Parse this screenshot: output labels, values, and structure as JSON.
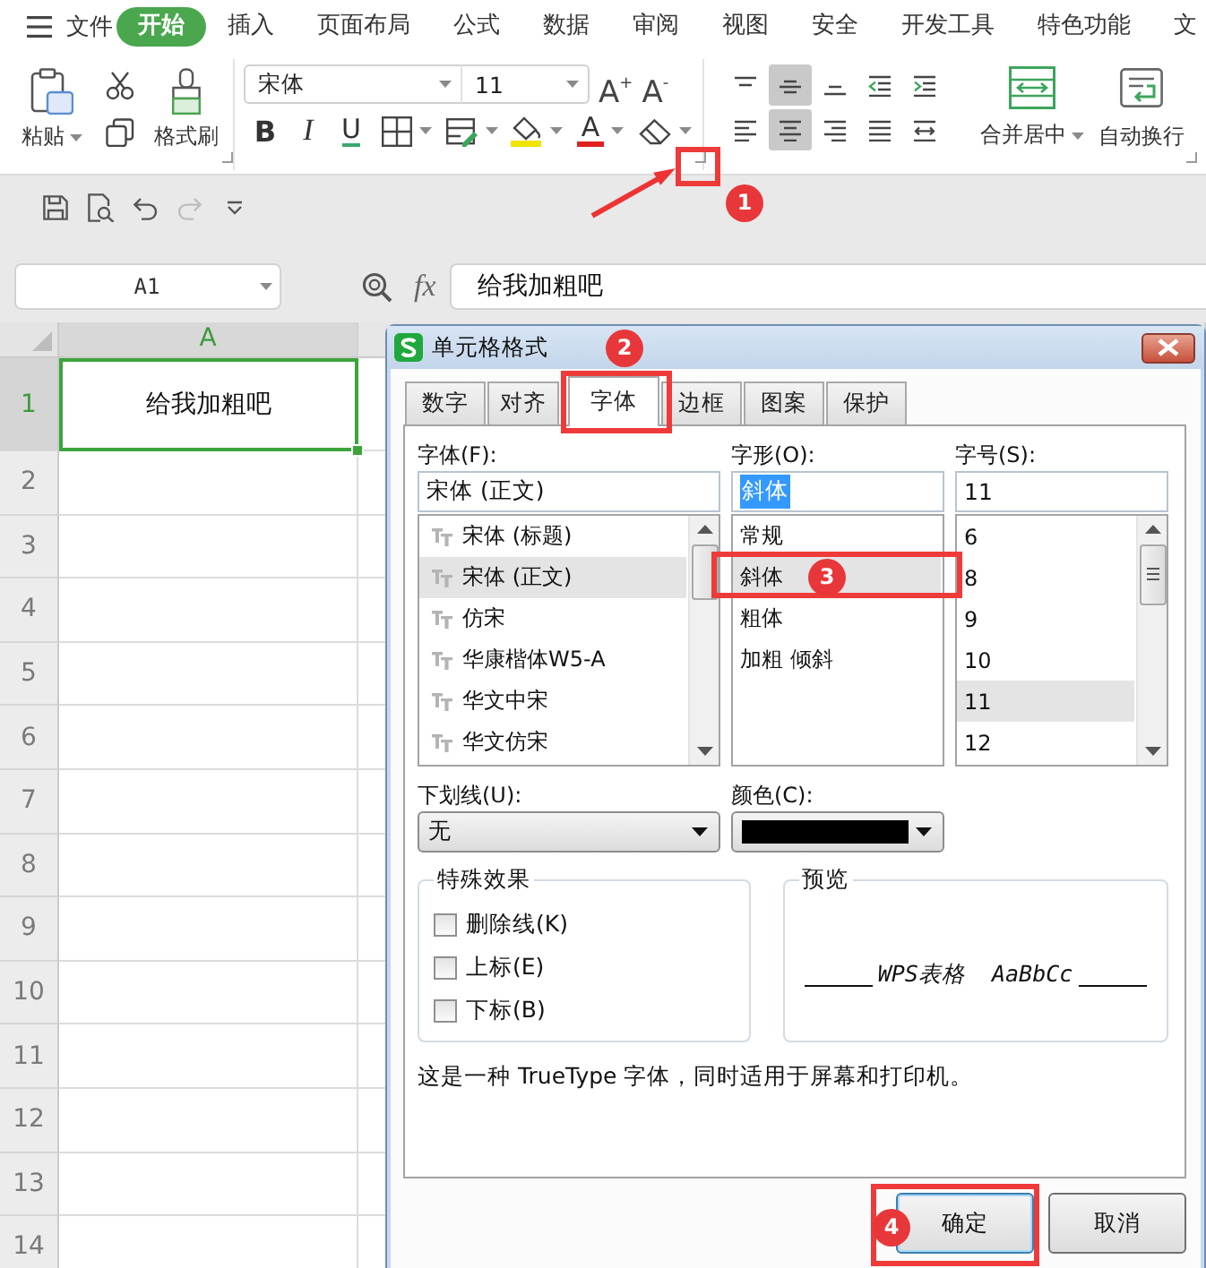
{
  "menu_bar": {
    "file_menu": "文件",
    "tabs": [
      {
        "label": "开始",
        "selected": true
      },
      {
        "label": "插入",
        "selected": false
      },
      {
        "label": "页面布局",
        "selected": false
      },
      {
        "label": "公式",
        "selected": false
      },
      {
        "label": "数据",
        "selected": false
      },
      {
        "label": "审阅",
        "selected": false
      },
      {
        "label": "视图",
        "selected": false
      },
      {
        "label": "安全",
        "selected": false
      },
      {
        "label": "开发工具",
        "selected": false
      },
      {
        "label": "特色功能",
        "selected": false
      },
      {
        "label": "文",
        "selected": false
      }
    ]
  },
  "ribbon": {
    "paste": "粘贴",
    "format_painter": "格式刷",
    "font_name": "宋体",
    "font_size": "11",
    "grow_font": "A$^{+}$",
    "shrink_font": "A$^{-}$",
    "bold": "B",
    "italic": "I",
    "underline": "U",
    "font_color_label": "A",
    "alignment_buttons": [
      {
        "kind": "top",
        "on": false
      },
      {
        "kind": "middle",
        "on": true
      },
      {
        "kind": "bottom",
        "on": false
      },
      {
        "kind": "outdent",
        "on": false
      },
      {
        "kind": "indent",
        "on": false
      },
      {
        "kind": "left",
        "on": false
      },
      {
        "kind": "center",
        "on": true
      },
      {
        "kind": "right",
        "on": false
      },
      {
        "kind": "justify",
        "on": false
      },
      {
        "kind": "distributed",
        "on": false
      }
    ],
    "merge_center": "合并居中",
    "wrap_text": "自动换行"
  },
  "quick_access": [
    {
      "kind": "save",
      "disabled": false
    },
    {
      "kind": "print_preview",
      "disabled": false
    },
    {
      "kind": "undo",
      "disabled": false
    },
    {
      "kind": "redo",
      "disabled": true
    },
    {
      "kind": "customize",
      "disabled": false
    }
  ],
  "formula_bar": {
    "name_box": "A1",
    "fx": "fx",
    "formula": "给我加粗吧"
  },
  "sheet": {
    "columns": [
      {
        "label": "A",
        "selected": true
      }
    ],
    "rows": [
      {
        "label": "1",
        "selected": true
      },
      {
        "label": "2",
        "selected": false
      },
      {
        "label": "3",
        "selected": false
      },
      {
        "label": "4",
        "selected": false
      },
      {
        "label": "5",
        "selected": false
      },
      {
        "label": "6",
        "selected": false
      },
      {
        "label": "7",
        "selected": false
      },
      {
        "label": "8",
        "selected": false
      },
      {
        "label": "9",
        "selected": false
      },
      {
        "label": "10",
        "selected": false
      },
      {
        "label": "11",
        "selected": false
      },
      {
        "label": "12",
        "selected": false
      },
      {
        "label": "13",
        "selected": false
      },
      {
        "label": "14",
        "selected": false
      }
    ],
    "cells": [
      {
        "value": "给我加粗吧",
        "selected": true
      }
    ]
  },
  "dialog": {
    "title": "单元格格式",
    "tabs": [
      {
        "label": "数字",
        "selected": false
      },
      {
        "label": "对齐",
        "selected": false
      },
      {
        "label": "字体",
        "selected": true
      },
      {
        "label": "边框",
        "selected": false
      },
      {
        "label": "图案",
        "selected": false
      },
      {
        "label": "保护",
        "selected": false
      }
    ],
    "font": {
      "label": "字体(F):",
      "value": "宋体 (正文)",
      "items": [
        {
          "label": "宋体 (标题)",
          "selected": false
        },
        {
          "label": "宋体 (正文)",
          "selected": true
        },
        {
          "label": "仿宋",
          "selected": false
        },
        {
          "label": "华康楷体W5-A",
          "selected": false
        },
        {
          "label": "华文中宋",
          "selected": false
        },
        {
          "label": "华文仿宋",
          "selected": false
        }
      ]
    },
    "style": {
      "label": "字形(O):",
      "value": "斜体",
      "text_selected": true,
      "items": [
        {
          "label": "常规",
          "selected": false
        },
        {
          "label": "斜体",
          "selected": true
        },
        {
          "label": "粗体",
          "selected": false
        },
        {
          "label": "加粗 倾斜",
          "selected": false
        }
      ]
    },
    "size": {
      "label": "字号(S):",
      "value": "11",
      "items": [
        {
          "label": "6",
          "selected": false
        },
        {
          "label": "8",
          "selected": false
        },
        {
          "label": "9",
          "selected": false
        },
        {
          "label": "10",
          "selected": false
        },
        {
          "label": "11",
          "selected": true
        },
        {
          "label": "12",
          "selected": false
        }
      ]
    },
    "underline": {
      "label": "下划线(U):",
      "value": "无"
    },
    "color": {
      "label": "颜色(C):",
      "color": "#000000"
    },
    "effects": {
      "legend": "特殊效果",
      "options": [
        {
          "label": "删除线(K)",
          "checked": false
        },
        {
          "label": "上标(E)",
          "checked": false
        },
        {
          "label": "下标(B)",
          "checked": false
        }
      ]
    },
    "preview": {
      "legend": "预览",
      "sample": "WPS表格  AaBbCc"
    },
    "info": "这是一种 TrueType 字体，同时适用于屏幕和打印机。",
    "buttons": [
      "确定",
      "取消"
    ]
  },
  "annotations": [
    {
      "number": "1"
    },
    {
      "number": "2"
    },
    {
      "number": "3"
    },
    {
      "number": "4"
    }
  ]
}
